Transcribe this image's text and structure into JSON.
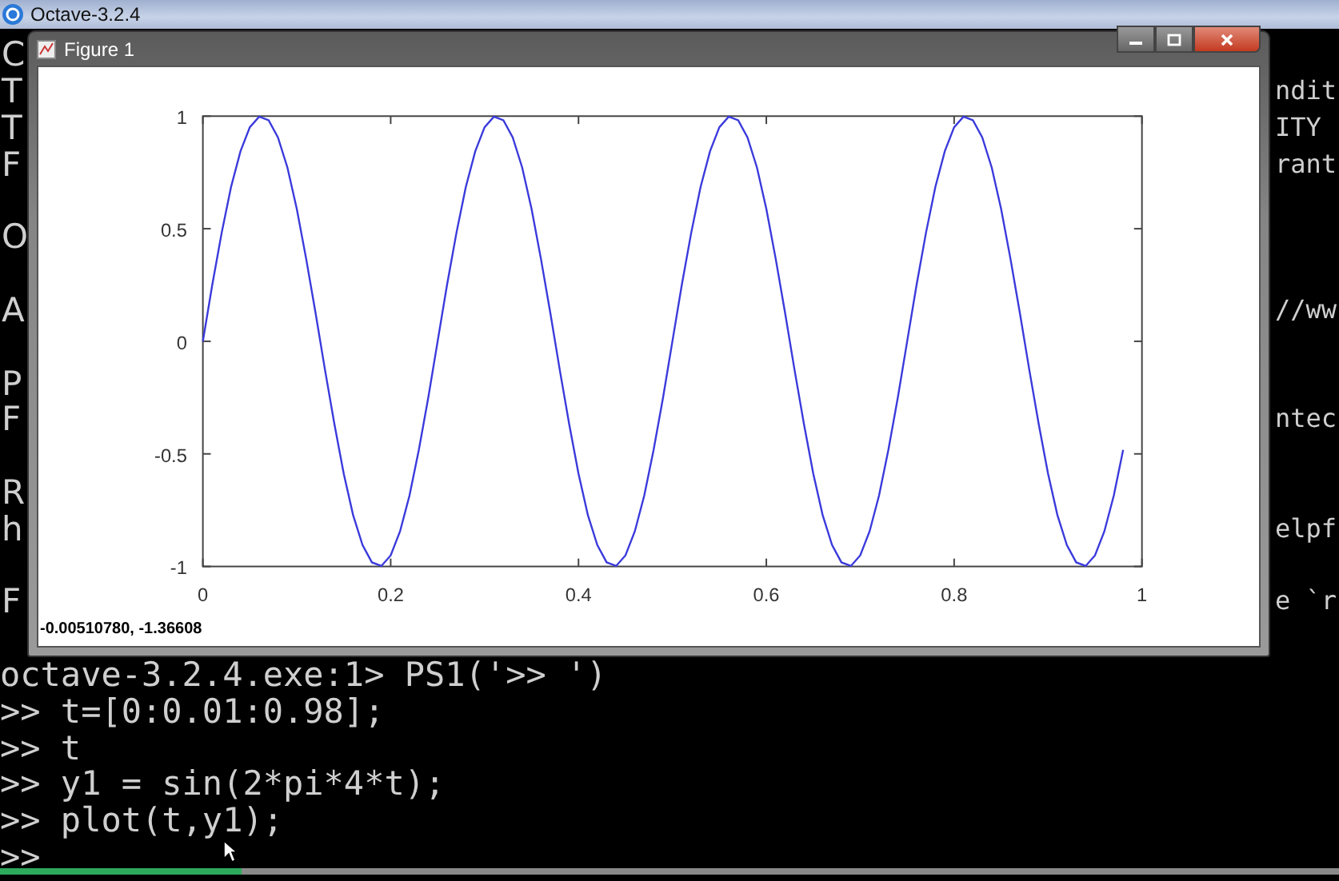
{
  "app_title": "Octave-3.2.4",
  "console": {
    "lines": [
      {
        "kind": "text",
        "left": "C"
      },
      {
        "kind": "text",
        "left": "T",
        "right": "ndit"
      },
      {
        "kind": "text",
        "left": "T",
        "right": "ITY"
      },
      {
        "kind": "text",
        "left": "F",
        "right": "rant"
      },
      {
        "kind": "blank"
      },
      {
        "kind": "text",
        "left": "O"
      },
      {
        "kind": "blank"
      },
      {
        "kind": "text",
        "left": "A",
        "right": "//ww"
      },
      {
        "kind": "blank"
      },
      {
        "kind": "text",
        "left": "P"
      },
      {
        "kind": "text",
        "left": "F",
        "right": "ntec"
      },
      {
        "kind": "blank"
      },
      {
        "kind": "text",
        "left": "R"
      },
      {
        "kind": "text",
        "left": "h",
        "right": "elpf"
      },
      {
        "kind": "blank"
      },
      {
        "kind": "text",
        "left": "F",
        "right": "e `r"
      },
      {
        "kind": "blank"
      },
      {
        "kind": "command",
        "text": "octave-3.2.4.exe:1> PS1('>> ')"
      },
      {
        "kind": "command",
        "text": ">> t=[0:0.01:0.98];"
      },
      {
        "kind": "command",
        "text": ">> t"
      },
      {
        "kind": "command",
        "text": ">> y1 = sin(2*pi*4*t);"
      },
      {
        "kind": "command",
        "text": ">> plot(t,y1);"
      },
      {
        "kind": "command",
        "text": ">>"
      }
    ]
  },
  "figure": {
    "title": "Figure 1",
    "status": "-0.00510780, -1.36608",
    "chart_data": {
      "type": "line",
      "xlim": [
        0,
        1
      ],
      "ylim": [
        -1,
        1
      ],
      "xticks": [
        {
          "value": 0,
          "label": "0"
        },
        {
          "value": 0.2,
          "label": "0.2"
        },
        {
          "value": 0.4,
          "label": "0.4"
        },
        {
          "value": 0.6,
          "label": "0.6"
        },
        {
          "value": 0.8,
          "label": "0.8"
        },
        {
          "value": 1,
          "label": "1"
        }
      ],
      "yticks": [
        {
          "value": -1,
          "label": "-1"
        },
        {
          "value": -0.5,
          "label": "-0.5"
        },
        {
          "value": 0,
          "label": "0"
        },
        {
          "value": 0.5,
          "label": "0.5"
        },
        {
          "value": 1,
          "label": "1"
        }
      ],
      "x": [
        0,
        0.01,
        0.02,
        0.03,
        0.04,
        0.05,
        0.06,
        0.07,
        0.08,
        0.09,
        0.1,
        0.11,
        0.12,
        0.13,
        0.14,
        0.15,
        0.16,
        0.17,
        0.18,
        0.19,
        0.2,
        0.21,
        0.22,
        0.23,
        0.24,
        0.25,
        0.26,
        0.27,
        0.28,
        0.29,
        0.3,
        0.31,
        0.32,
        0.33,
        0.34,
        0.35,
        0.36,
        0.37,
        0.38,
        0.39,
        0.4,
        0.41,
        0.42,
        0.43,
        0.44,
        0.45,
        0.46,
        0.47,
        0.48,
        0.49,
        0.5,
        0.51,
        0.52,
        0.53,
        0.54,
        0.55,
        0.56,
        0.57,
        0.58,
        0.59,
        0.6,
        0.61,
        0.62,
        0.63,
        0.64,
        0.65,
        0.66,
        0.67,
        0.68,
        0.69,
        0.7,
        0.71,
        0.72,
        0.73,
        0.74,
        0.75,
        0.76,
        0.77,
        0.78,
        0.79,
        0.8,
        0.81,
        0.82,
        0.83,
        0.84,
        0.85,
        0.86,
        0.87,
        0.88,
        0.89,
        0.9,
        0.91,
        0.92,
        0.93,
        0.94,
        0.95,
        0.96,
        0.97,
        0.98
      ],
      "series": [
        {
          "color": "#3a3adc",
          "values": [
            0,
            0.249,
            0.482,
            0.685,
            0.844,
            0.951,
            0.998,
            0.982,
            0.905,
            0.771,
            0.588,
            0.368,
            0.125,
            -0.125,
            -0.368,
            -0.588,
            -0.771,
            -0.905,
            -0.982,
            -0.998,
            -0.951,
            -0.844,
            -0.685,
            -0.482,
            -0.249,
            0,
            0.249,
            0.482,
            0.685,
            0.844,
            0.951,
            0.998,
            0.982,
            0.905,
            0.771,
            0.588,
            0.368,
            0.125,
            -0.125,
            -0.368,
            -0.588,
            -0.771,
            -0.905,
            -0.982,
            -0.998,
            -0.951,
            -0.844,
            -0.685,
            -0.482,
            -0.249,
            0,
            0.249,
            0.482,
            0.685,
            0.844,
            0.951,
            0.998,
            0.982,
            0.905,
            0.771,
            0.588,
            0.368,
            0.125,
            -0.125,
            -0.368,
            -0.588,
            -0.771,
            -0.905,
            -0.982,
            -0.998,
            -0.951,
            -0.844,
            -0.685,
            -0.482,
            -0.249,
            0,
            0.249,
            0.482,
            0.685,
            0.844,
            0.951,
            0.998,
            0.982,
            0.905,
            0.771,
            0.588,
            0.368,
            0.125,
            -0.125,
            -0.368,
            -0.588,
            -0.771,
            -0.905,
            -0.982,
            -0.998,
            -0.951,
            -0.844,
            -0.685,
            -0.482
          ]
        }
      ]
    }
  },
  "video_progress": {
    "level": 0.18
  }
}
